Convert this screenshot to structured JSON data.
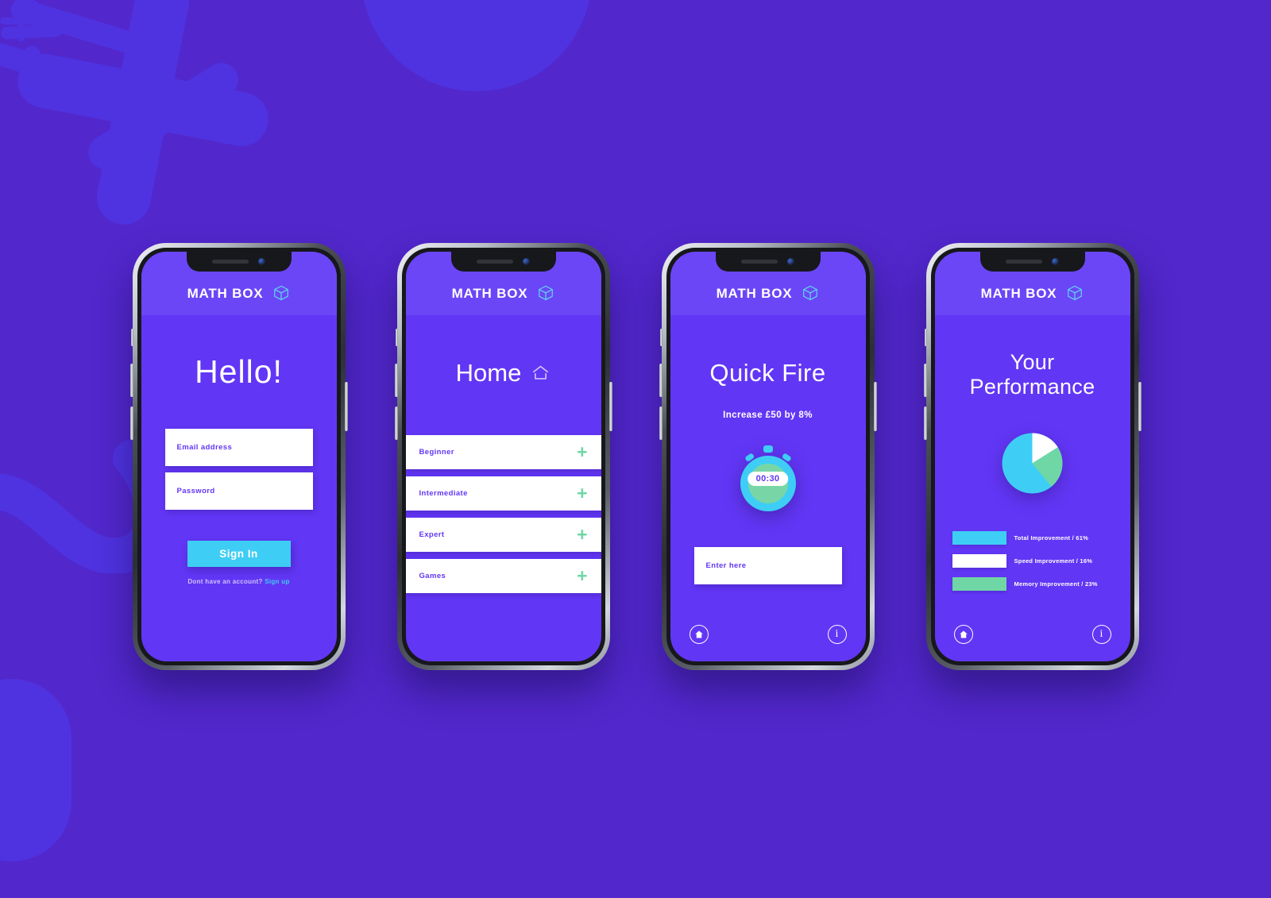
{
  "app": {
    "name": "MATH BOX",
    "logo_icon": "cube-icon",
    "accent_cyan": "#3ecef5",
    "accent_green": "#6fd7a6",
    "brand_purple": "#6236f5",
    "header_purple": "#6b46f7",
    "page_background": "#5227cc"
  },
  "background_shapes": [
    {
      "name": "plus-large",
      "icon": "plus-icon"
    },
    {
      "name": "plus-small",
      "icon": "plus-icon"
    },
    {
      "name": "divide",
      "icon": "divide-icon"
    },
    {
      "name": "equals",
      "icon": "equals-icon"
    },
    {
      "name": "slash-bar",
      "icon": "minus-icon"
    },
    {
      "name": "squiggle",
      "icon": "wave-icon"
    },
    {
      "name": "blob-top",
      "icon": "blob-icon"
    },
    {
      "name": "blob-left",
      "icon": "blob-icon"
    }
  ],
  "screens": {
    "signin": {
      "heading": "Hello!",
      "fields": [
        {
          "label": "Email address",
          "name": "email-field"
        },
        {
          "label": "Password",
          "name": "password-field"
        }
      ],
      "submit_label": "Sign In",
      "footer_text": "Dont have an account?",
      "footer_link": "Sign up"
    },
    "home": {
      "heading": "Home",
      "heading_icon": "home-icon",
      "items": [
        {
          "label": "Beginner",
          "action_icon": "plus-icon"
        },
        {
          "label": "Intermediate",
          "action_icon": "plus-icon"
        },
        {
          "label": "Expert",
          "action_icon": "plus-icon"
        },
        {
          "label": "Games",
          "action_icon": "plus-icon"
        }
      ]
    },
    "quickfire": {
      "heading": "Quick Fire",
      "question": "Increase £50 by 8%",
      "timer_value": "00:30",
      "timer_icon": "stopwatch-icon",
      "answer_placeholder": "Enter here",
      "nav": {
        "home_icon": "home-icon",
        "info_icon": "info-icon",
        "info_glyph": "i"
      }
    },
    "performance": {
      "heading_line1": "Your",
      "heading_line2": "Performance",
      "nav": {
        "home_icon": "home-icon",
        "info_icon": "info-icon",
        "info_glyph": "i"
      },
      "chart_data": {
        "type": "pie",
        "title": "Your Performance",
        "categories": [
          "Total Improvement",
          "Speed Improvement",
          "Memory Improvement"
        ],
        "values": [
          61,
          16,
          23
        ],
        "labels": [
          "Total Improvement / 61%",
          "Speed Improvement / 16%",
          "Memory Improvement / 23%"
        ],
        "colors": [
          "#3ecef5",
          "#ffffff",
          "#6fd7a6"
        ],
        "unit": "%",
        "legend_position": "bottom"
      }
    }
  }
}
